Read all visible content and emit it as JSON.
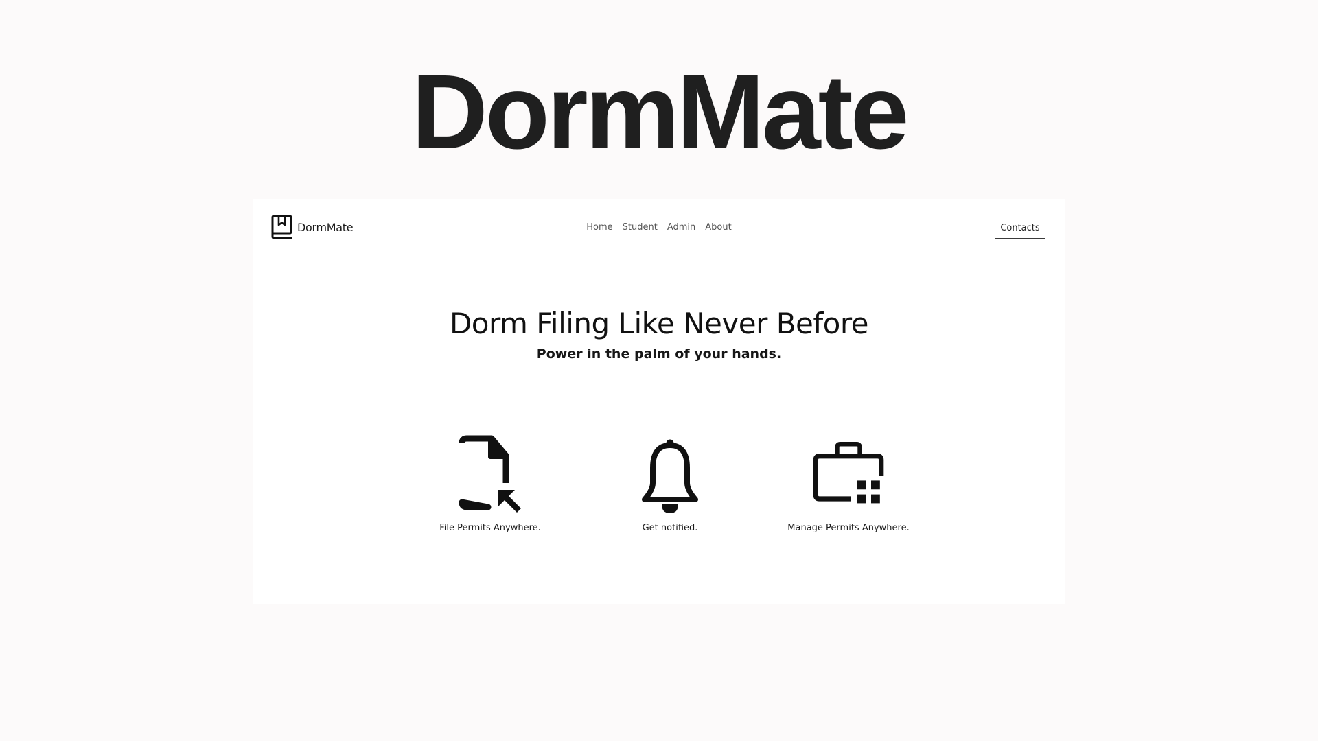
{
  "hero": {
    "title": "DormMate"
  },
  "navbar": {
    "brand_name": "DormMate",
    "brand_icon": "book-bookmark-icon",
    "links": [
      {
        "label": "Home"
      },
      {
        "label": "Student"
      },
      {
        "label": "Admin"
      },
      {
        "label": "About"
      }
    ],
    "contacts_label": "Contacts"
  },
  "main": {
    "headline": "Dorm Filing Like Never Before",
    "subheadline": "Power in the palm of your hands."
  },
  "features": [
    {
      "label": "File Permits Anywhere.",
      "icon": "document-pointer-icon"
    },
    {
      "label": "Get notified.",
      "icon": "bell-icon"
    },
    {
      "label": "Manage Permits Anywhere.",
      "icon": "briefcase-grid-icon"
    }
  ],
  "colors": {
    "page_background": "#fcfafa",
    "frame_background": "#ffffff",
    "text": "#111111",
    "nav_link": "#555555"
  }
}
